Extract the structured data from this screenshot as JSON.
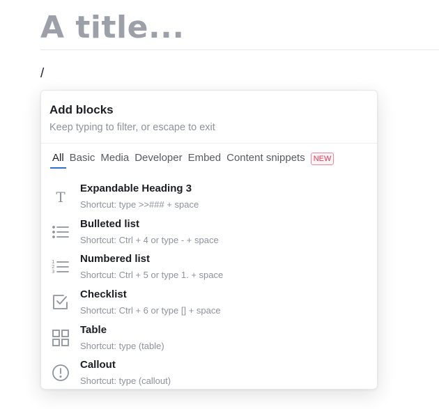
{
  "page": {
    "title": "A title...",
    "slash": "/"
  },
  "menu": {
    "title": "Add blocks",
    "subtitle": "Keep typing to filter, or escape to exit",
    "tabs": [
      {
        "label": "All",
        "active": true
      },
      {
        "label": "Basic"
      },
      {
        "label": "Media"
      },
      {
        "label": "Developer"
      },
      {
        "label": "Embed"
      },
      {
        "label": "Content snippets"
      }
    ],
    "new_badge": "NEW",
    "items": [
      {
        "name": "Expandable Heading 3",
        "hint": "Shortcut: type >>### + space",
        "icon": "text-icon"
      },
      {
        "name": "Bulleted list",
        "hint": "Shortcut: Ctrl + 4 or type - + space",
        "icon": "bulleted-list-icon"
      },
      {
        "name": "Numbered list",
        "hint": "Shortcut: Ctrl + 5 or type 1. + space",
        "icon": "numbered-list-icon"
      },
      {
        "name": "Checklist",
        "hint": "Shortcut: Ctrl + 6 or type [] + space",
        "icon": "checkbox-icon"
      },
      {
        "name": "Table",
        "hint": "Shortcut: type (table)",
        "icon": "grid-icon"
      },
      {
        "name": "Callout",
        "hint": "Shortcut: type (callout)",
        "icon": "exclamation-circle-icon"
      }
    ]
  },
  "colors": {
    "accent": "#2b6fcf",
    "badge": "#d63a57",
    "title_placeholder": "#9ca0a8",
    "icon": "#8d929b"
  }
}
